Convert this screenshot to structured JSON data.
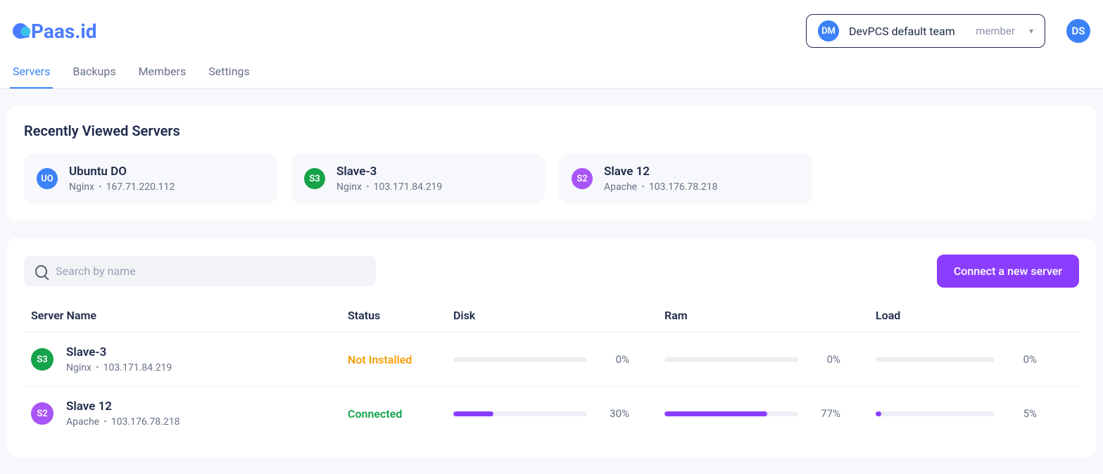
{
  "logo_text": "Paas.id",
  "team_selector": {
    "initials": "DM",
    "name": "DevPCS default team",
    "role": "member"
  },
  "user_avatar": "DS",
  "tabs": {
    "servers": "Servers",
    "backups": "Backups",
    "members": "Members",
    "settings": "Settings"
  },
  "recent": {
    "title": "Recently Viewed Servers",
    "items": [
      {
        "initials": "UO",
        "color": "blue",
        "name": "Ubuntu DO",
        "stack": "Nginx",
        "ip": "167.71.220.112"
      },
      {
        "initials": "S3",
        "color": "green",
        "name": "Slave-3",
        "stack": "Nginx",
        "ip": "103.171.84.219"
      },
      {
        "initials": "S2",
        "color": "purple",
        "name": "Slave 12",
        "stack": "Apache",
        "ip": "103.176.78.218"
      }
    ]
  },
  "list": {
    "search_placeholder": "Search by name",
    "connect_btn": "Connect a new server",
    "headers": {
      "name": "Server Name",
      "status": "Status",
      "disk": "Disk",
      "ram": "Ram",
      "load": "Load"
    },
    "rows": [
      {
        "initials": "S3",
        "color": "green",
        "name": "Slave-3",
        "stack": "Nginx",
        "ip": "103.171.84.219",
        "status_label": "Not Installed",
        "status_class": "stat-ni",
        "disk": {
          "pct": 0,
          "label": "0%"
        },
        "ram": {
          "pct": 0,
          "label": "0%"
        },
        "load": {
          "pct": 0,
          "label": "0%"
        }
      },
      {
        "initials": "S2",
        "color": "purple",
        "name": "Slave 12",
        "stack": "Apache",
        "ip": "103.176.78.218",
        "status_label": "Connected",
        "status_class": "stat-c",
        "disk": {
          "pct": 30,
          "label": "30%"
        },
        "ram": {
          "pct": 77,
          "label": "77%"
        },
        "load": {
          "pct": 5,
          "label": "5%"
        }
      }
    ]
  }
}
